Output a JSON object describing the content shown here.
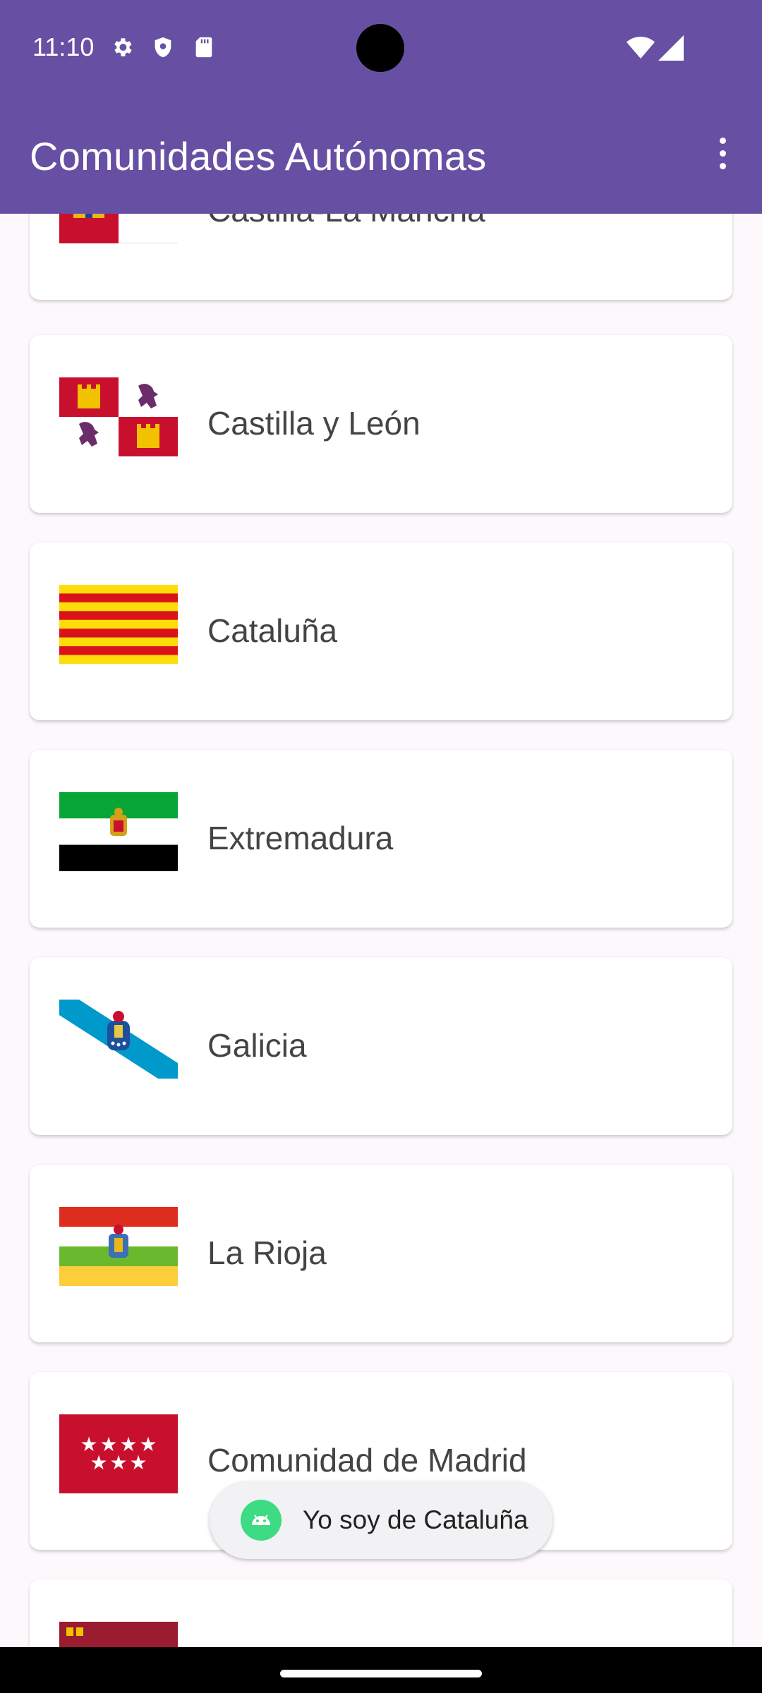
{
  "status": {
    "time": "11:10",
    "left_icons": [
      "settings-icon",
      "shield-icon",
      "sd-card-icon"
    ],
    "right_icons": [
      "wifi-icon",
      "signal-icon"
    ]
  },
  "appbar": {
    "title": "Comunidades Autónomas",
    "menu_icon": "more-vert-icon"
  },
  "list": {
    "items": [
      {
        "label": "Castilla-La Mancha",
        "flag": "castilla-la-mancha-flag"
      },
      {
        "label": "Castilla y León",
        "flag": "castilla-y-leon-flag"
      },
      {
        "label": "Cataluña",
        "flag": "cataluna-flag"
      },
      {
        "label": "Extremadura",
        "flag": "extremadura-flag"
      },
      {
        "label": "Galicia",
        "flag": "galicia-flag"
      },
      {
        "label": "La Rioja",
        "flag": "la-rioja-flag"
      },
      {
        "label": "Comunidad de Madrid",
        "flag": "madrid-flag"
      },
      {
        "label": "",
        "flag": "murcia-flag"
      }
    ]
  },
  "toast": {
    "text": "Yo soy de Cataluña",
    "icon": "android-icon"
  },
  "colors": {
    "primary": "#6750a4",
    "background": "#fdf8fc"
  }
}
